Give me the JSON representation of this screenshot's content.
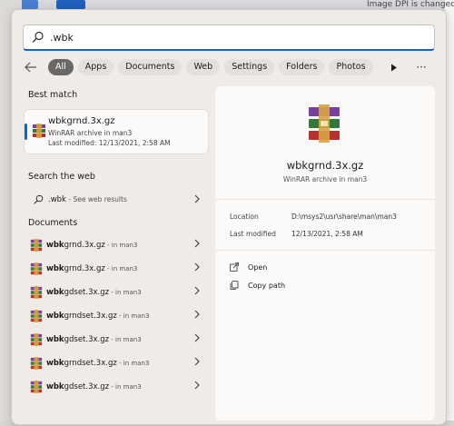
{
  "background": {
    "top_right_text": "Image DPI is changed"
  },
  "search": {
    "query": ".wbk"
  },
  "filters": {
    "chips": [
      "All",
      "Apps",
      "Documents",
      "Web",
      "Settings",
      "Folders",
      "Photos"
    ],
    "more_label": "···"
  },
  "best_match": {
    "section_title": "Best match",
    "name": "wbkgrnd.3x.gz",
    "type": "WinRAR archive in man3",
    "modified": "Last modified: 12/13/2021, 2:58 AM"
  },
  "web": {
    "section_title": "Search the web",
    "query": ".wbk",
    "suffix": " - See web results"
  },
  "documents": {
    "section_title": "Documents",
    "items": [
      {
        "bold": "wbk",
        "rest": "grnd.3x.gz",
        "location": " - in man3"
      },
      {
        "bold": "wbk",
        "rest": "grnd.3x.gz",
        "location": " - in man3"
      },
      {
        "bold": "wbk",
        "rest": "gdset.3x.gz",
        "location": " - in man3"
      },
      {
        "bold": "wbk",
        "rest": "grndset.3x.gz",
        "location": " - in man3"
      },
      {
        "bold": "wbk",
        "rest": "gdset.3x.gz",
        "location": " - in man3"
      },
      {
        "bold": "wbk",
        "rest": "grndset.3x.gz",
        "location": " - in man3"
      },
      {
        "bold": "wbk",
        "rest": "gdset.3x.gz",
        "location": " - in man3"
      }
    ]
  },
  "details": {
    "title": "wbkgrnd.3x.gz",
    "subtitle": "WinRAR archive in man3",
    "location_label": "Location",
    "location_value": "D:\\msys2\\usr\\share\\man\\man3",
    "modified_label": "Last modified",
    "modified_value": "12/13/2021, 2:58 AM",
    "actions": [
      "Open",
      "Copy path"
    ]
  },
  "colors": {
    "accent": "#1f5fbf",
    "active_chip": "#6a6866"
  }
}
